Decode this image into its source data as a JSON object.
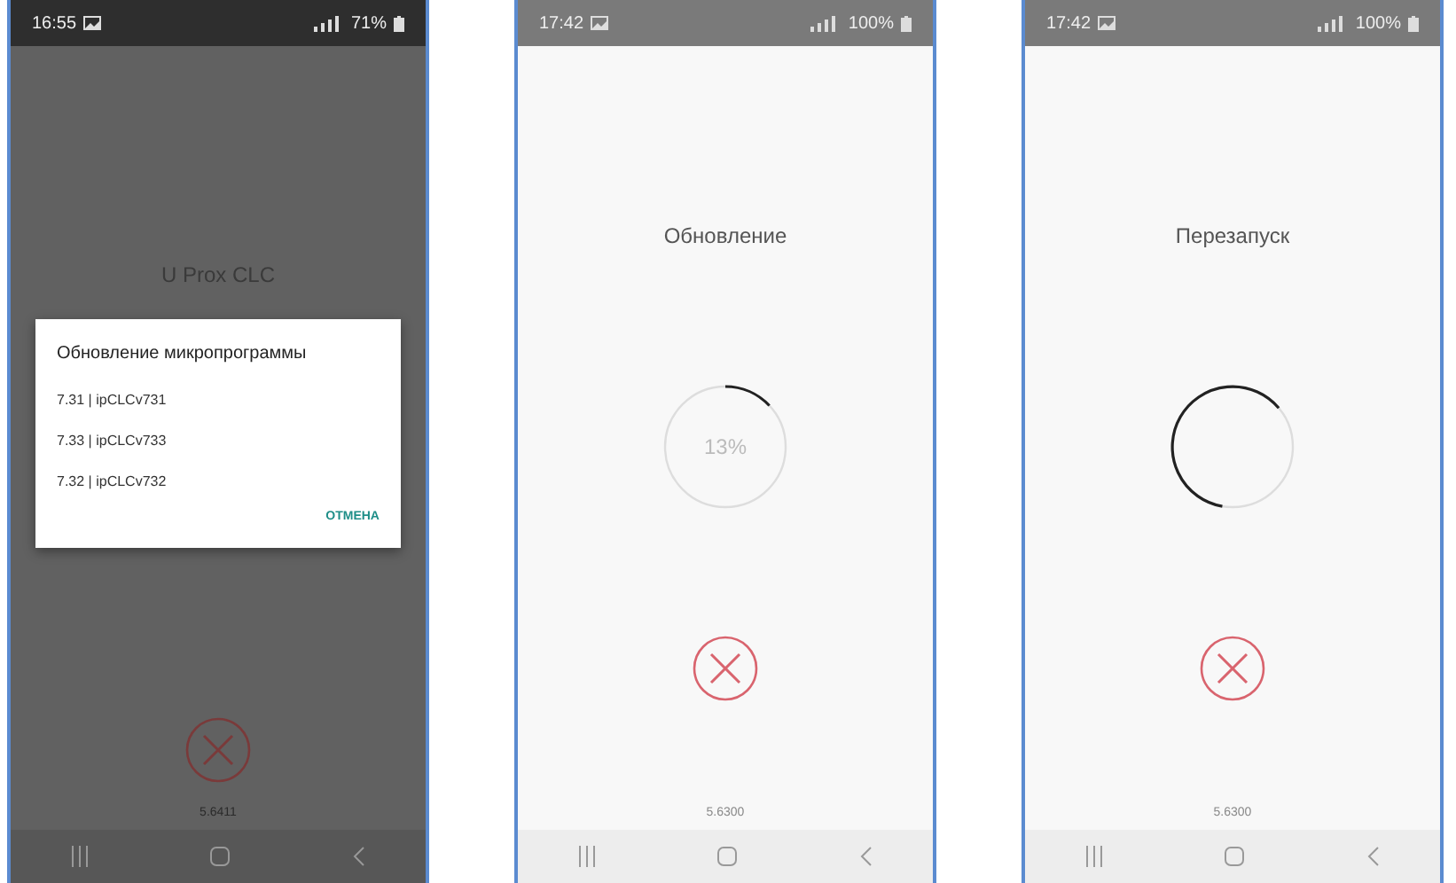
{
  "screens": [
    {
      "kind": "dialog",
      "status_bar": {
        "time": "16:55",
        "battery": "71%"
      },
      "app_title": "U Prox CLC",
      "dialog": {
        "title": "Обновление микропрограммы",
        "options": [
          "7.31 | ipCLCv731",
          "7.33 | ipCLCv733",
          "7.32 | ipCLCv732"
        ],
        "cancel": "ОТМЕНА"
      },
      "version": "5.6411"
    },
    {
      "kind": "progress",
      "status_bar": {
        "time": "17:42",
        "battery": "100%"
      },
      "heading": "Обновление",
      "progress": {
        "level": 0.13,
        "label": "13%"
      },
      "version": "5.6300"
    },
    {
      "kind": "spinner",
      "status_bar": {
        "time": "17:42",
        "battery": "100%"
      },
      "heading": "Перезапуск",
      "version": "5.6300"
    }
  ]
}
